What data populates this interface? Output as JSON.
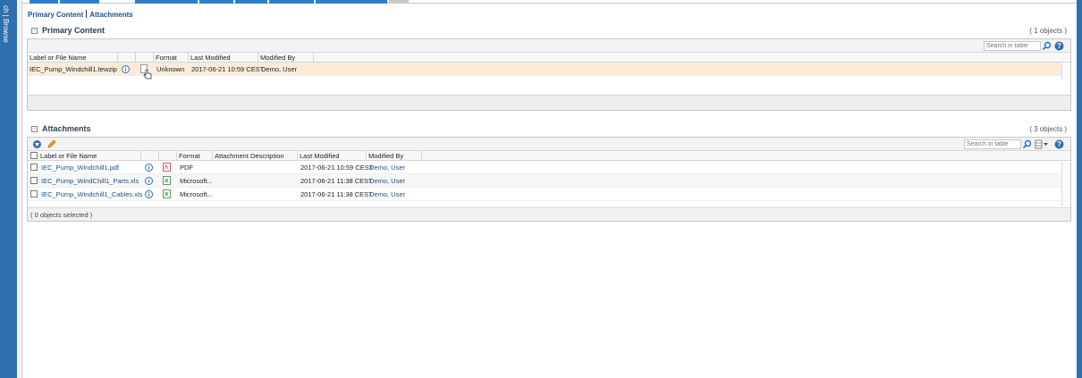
{
  "sidebar": {
    "label": "ch | Browse",
    "color": "#2f6fb0"
  },
  "subnav": {
    "primary": "Primary Content",
    "attachments": "Attachments"
  },
  "primary": {
    "title": "Primary Content",
    "count": "( 1 objects )",
    "search_placeholder": "Search in table",
    "columns": [
      "Label or File Name",
      "Format",
      "Last Modified",
      "Modified By"
    ],
    "rows": [
      {
        "name": "IEC_Pump_Windchill1.tewzip",
        "format": "Unknown",
        "modified": "2017-06-21 10:59 CEST",
        "by": "Demo, User"
      }
    ]
  },
  "attachments": {
    "title": "Attachments",
    "count": "( 3 objects )",
    "search_placeholder": "Search in table",
    "columns": [
      "Label or File Name",
      "Format",
      "Attachment Description",
      "Last Modified",
      "Modified By"
    ],
    "rows": [
      {
        "name": "IEC_Pump_Windchill1.pdf",
        "icon": "pdf-icon",
        "format": "PDF",
        "desc": "",
        "modified": "2017-06-21 10:59 CEST",
        "by": "Demo, User"
      },
      {
        "name": "IEC_Pump_WindChill1_Parts.xls",
        "icon": "excel-icon",
        "format": "Microsoft...",
        "desc": "",
        "modified": "2017-06-21 11:38 CEST",
        "by": "Demo, User"
      },
      {
        "name": "IEC_Pump_Windchill1_Cables.xls",
        "icon": "excel-icon",
        "format": "Microsoft...",
        "desc": "",
        "modified": "2017-06-21 11:38 CEST",
        "by": "Demo, User"
      }
    ],
    "footer": "( 0 objects selected )"
  },
  "colors": {
    "accent": "#2f7fce",
    "selected_row": "#fcebd9",
    "link": "#1f4e86"
  }
}
